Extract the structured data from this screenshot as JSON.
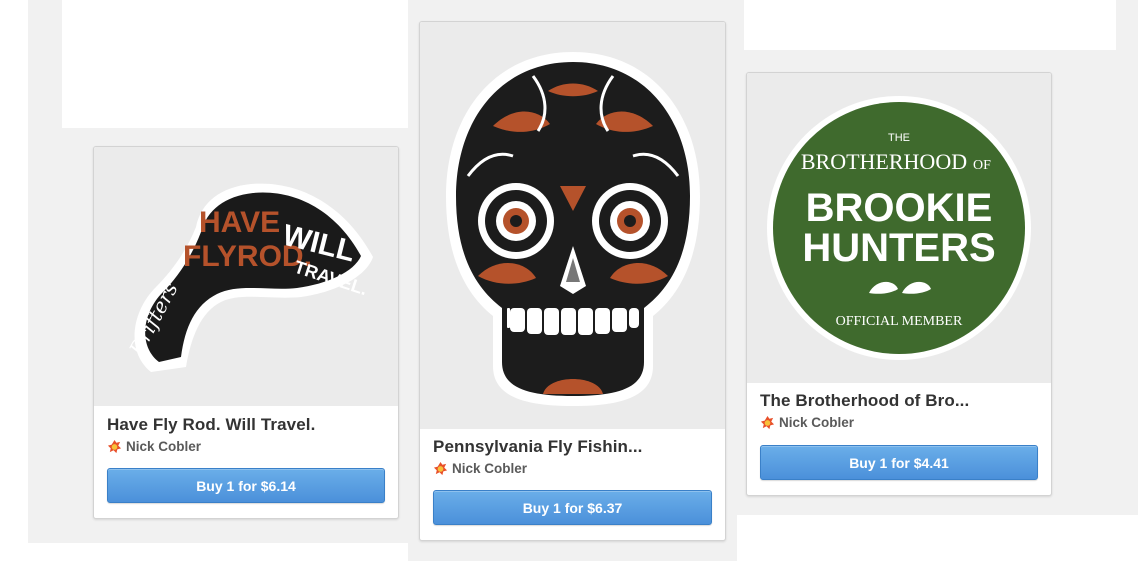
{
  "products": [
    {
      "title": "Have Fly Rod. Will Travel.",
      "seller": "Nick Cobler",
      "buy_label": "Buy 1 for $6.14",
      "sticker_text": {
        "line1": "HAVE",
        "line2": "FLYROD.",
        "line3": "WILL",
        "line4": "TRAVEL.",
        "script": "Drifters"
      }
    },
    {
      "title": "Pennsylvania Fly Fishin...",
      "seller": "Nick Cobler",
      "buy_label": "Buy 1 for $6.37"
    },
    {
      "title": "The Brotherhood of Bro...",
      "seller": "Nick Cobler",
      "buy_label": "Buy 1 for $4.41",
      "sticker_text": {
        "the": "THE",
        "brotherhood": "BROTHERHOOD",
        "of": "OF",
        "line1": "BROOKIE",
        "line2": "HUNTERS",
        "bottom": "OFFICIAL MEMBER"
      }
    }
  ],
  "colors": {
    "button_top": "#6aaee9",
    "button_bottom": "#4b90da",
    "sticker_orange": "#b5522b",
    "sticker_green": "#3f6a2d"
  },
  "icons": {
    "seller": "seller-badge-icon"
  }
}
